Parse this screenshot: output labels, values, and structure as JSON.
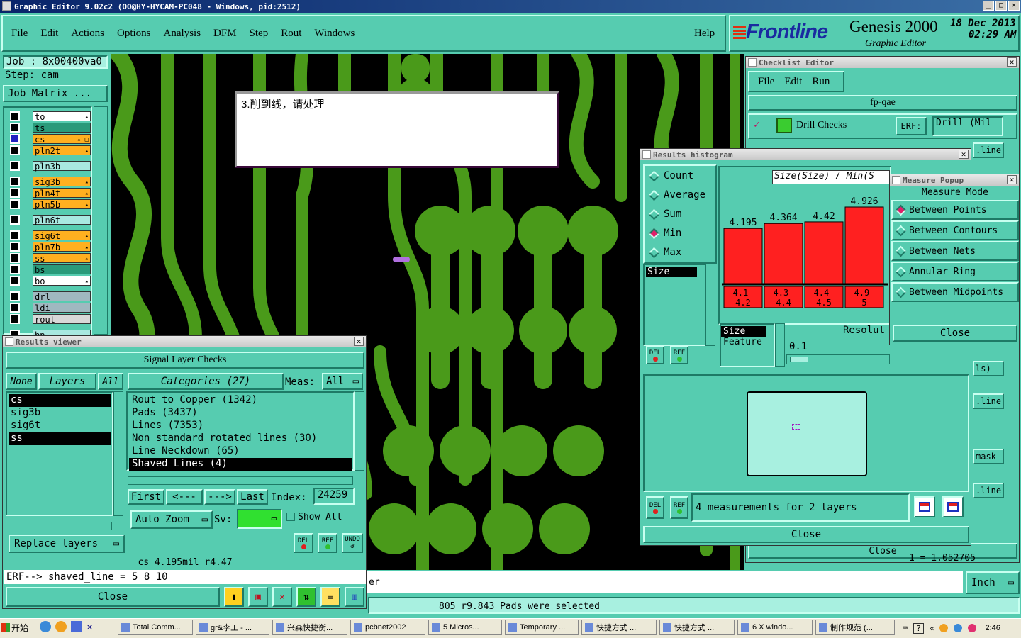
{
  "app": {
    "title": "Graphic Editor 9.02c2  (OO@HY-HYCAM-PC048 - Windows, pid:2512)"
  },
  "menu": {
    "items": [
      "File",
      "Edit",
      "Actions",
      "Options",
      "Analysis",
      "DFM",
      "Step",
      "Rout",
      "Windows"
    ],
    "help": "Help"
  },
  "brand": {
    "logo": "Frontline",
    "product": "Genesis 2000",
    "subtitle": "Graphic Editor",
    "date": "18 Dec 2013",
    "time": "02:29 AM"
  },
  "job": {
    "job_label": "Job : 8x00400va0",
    "step_label": "Step: cam",
    "matrix_button": "Job Matrix ..."
  },
  "layers": [
    {
      "name": "to",
      "color": "#ffffff",
      "tag": "▴"
    },
    {
      "name": "ts",
      "color": "#2a9a7a",
      "tag": ""
    },
    {
      "name": "cs",
      "color": "#ffb020",
      "tag": "▴ □",
      "active": true
    },
    {
      "name": "pln2t",
      "color": "#ffb020",
      "tag": "▴"
    },
    {
      "name": "pln3b",
      "color": "#a8e8e0",
      "tag": ""
    },
    {
      "name": "sig3b",
      "color": "#ffb020",
      "tag": "▴"
    },
    {
      "name": "pln4t",
      "color": "#ffb020",
      "tag": "▴"
    },
    {
      "name": "pln5b",
      "color": "#ffb020",
      "tag": "▴"
    },
    {
      "name": "pln6t",
      "color": "#a8e8e0",
      "tag": ""
    },
    {
      "name": "sig6t",
      "color": "#ffb020",
      "tag": "▴"
    },
    {
      "name": "pln7b",
      "color": "#ffb020",
      "tag": "▴"
    },
    {
      "name": "ss",
      "color": "#ffb020",
      "tag": "▴"
    },
    {
      "name": "bs",
      "color": "#2a9a7a",
      "tag": ""
    },
    {
      "name": "bo",
      "color": "#ffffff",
      "tag": "▴"
    },
    {
      "name": "drl",
      "color": "#a0b8c0",
      "tag": ""
    },
    {
      "name": "ldi",
      "color": "#a0b8c0",
      "tag": ""
    },
    {
      "name": "rout",
      "color": "#d8d8d8",
      "tag": ""
    },
    {
      "name": "bp",
      "color": "#a8e8e0",
      "tag": ""
    }
  ],
  "note": {
    "text": "3.削到线，请处理"
  },
  "checklist": {
    "title": "Checklist Editor",
    "menu": [
      "File",
      "Edit",
      "Run"
    ],
    "name": "fp-qae",
    "row_label": "Drill Checks",
    "erf_label": "ERF:",
    "erf_value": "Drill (Mil",
    "side_labels": [
      ".line...",
      "ls)",
      ".line...",
      "mask",
      ".line..."
    ],
    "close": "Close"
  },
  "histogram": {
    "title": "Results histogram",
    "modes": [
      {
        "label": "Count",
        "selected": false
      },
      {
        "label": "Average",
        "selected": false
      },
      {
        "label": "Sum",
        "selected": false
      },
      {
        "label": "Min",
        "selected": true
      },
      {
        "label": "Max",
        "selected": false
      }
    ],
    "list_item": "Size",
    "header": "Size(Size) / Min(S",
    "feature_list": [
      "Size",
      "Feature"
    ],
    "resolution_label": "Resolut",
    "resolution_value": "0.1",
    "status": "4 measurements for 2 layers",
    "close": "Close",
    "del": "DEL",
    "ref": "REF"
  },
  "chart_data": {
    "type": "bar",
    "title": "Size(Size) / Min(S",
    "categories": [
      "4.1-4.2",
      "4.3-4.4",
      "4.4-4.5",
      "4.9-5"
    ],
    "values": [
      4.195,
      4.364,
      4.42,
      4.926
    ],
    "colors": {
      "bar": "#ff2020",
      "bg": "#ffffff"
    }
  },
  "measure": {
    "title": "Measure Popup",
    "header": "Measure Mode",
    "options": [
      {
        "label": "Between Points",
        "selected": true
      },
      {
        "label": "Between Contours",
        "selected": false
      },
      {
        "label": "Between Nets",
        "selected": false
      },
      {
        "label": "Annular Ring",
        "selected": false
      },
      {
        "label": "Between Midpoints",
        "selected": false
      }
    ],
    "close": "Close"
  },
  "results": {
    "title": "Results viewer",
    "section": "Signal Layer Checks",
    "none_btn": "None",
    "layers_btn": "Layers",
    "all_btn": "All",
    "layers": [
      {
        "name": "cs",
        "selected": true
      },
      {
        "name": "sig3b",
        "selected": false
      },
      {
        "name": "sig6t",
        "selected": false
      },
      {
        "name": "ss",
        "selected": true
      }
    ],
    "categories_btn": "Categories (27)",
    "meas_label": "Meas:",
    "meas_value": "All",
    "categories": [
      {
        "label": "Rout to Copper (1342)",
        "selected": false
      },
      {
        "label": "Pads (3437)",
        "selected": false
      },
      {
        "label": "Lines (7353)",
        "selected": false
      },
      {
        "label": "Non standard rotated lines (30)",
        "selected": false
      },
      {
        "label": "Line Neckdown (65)",
        "selected": false
      },
      {
        "label": "Shaved Lines (4)",
        "selected": true
      }
    ],
    "first": "First",
    "prev": "<---",
    "next": "--->",
    "last": "Last",
    "index_label": "Index:",
    "index_value": "24259",
    "auto_zoom": "Auto Zoom",
    "sv_label": "Sv:",
    "show_all": "Show All",
    "replace_layers": "Replace layers",
    "status": "cs 4.195mil   r4.47",
    "erf_line": "ERF--> shaved_line = 5 8 10",
    "close": "Close",
    "del": "DEL",
    "ref": "REF",
    "undo": "UNDO"
  },
  "statusbar": {
    "cmd_tail": "er",
    "units": "Inch",
    "message": "805 r9.843 Pads were selected",
    "coord_hint": "1 = 1.052705"
  },
  "taskbar": {
    "start": "开始",
    "items": [
      "Total Comm...",
      "gr&李工 - ...",
      "兴森快捷衡...",
      "pcbnet2002",
      "5 Micros...",
      "Temporary ...",
      "快捷方式 ...",
      "快捷方式 ...",
      "6 X windo...",
      "制作规范 (..."
    ],
    "clock": "2:46"
  }
}
